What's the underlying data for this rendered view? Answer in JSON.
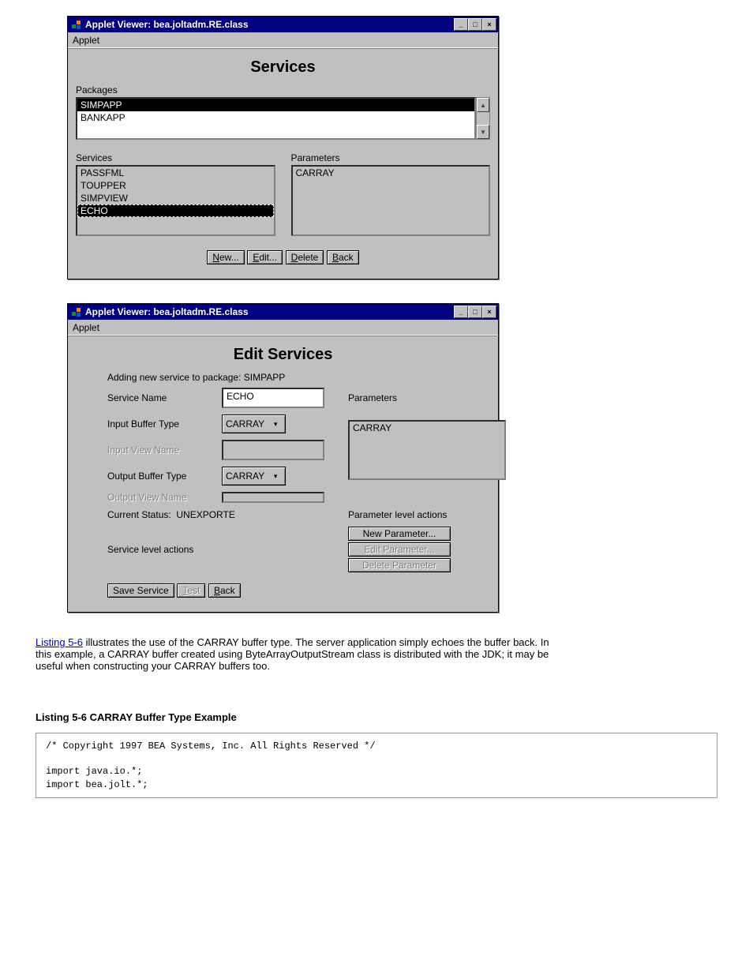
{
  "window1": {
    "title": "Applet Viewer: bea.joltadm.RE.class",
    "menu": "Applet",
    "heading": "Services",
    "packages_label": "Packages",
    "packages": [
      "SIMPAPP",
      "BANKAPP"
    ],
    "services_label": "Services",
    "services": [
      "PASSFML",
      "TOUPPER",
      "SIMPVIEW",
      "ECHO"
    ],
    "parameters_label": "Parameters",
    "parameters": [
      "CARRAY"
    ],
    "buttons": {
      "new": "New...",
      "edit": "Edit...",
      "delete": "Delete",
      "back": "Back"
    }
  },
  "window2": {
    "title": "Applet Viewer: bea.joltadm.RE.class",
    "menu": "Applet",
    "heading": "Edit Services",
    "subhead": "Adding new service to package: SIMPAPP",
    "labels": {
      "service_name": "Service Name",
      "input_buffer_type": "Input Buffer Type",
      "input_view_name": "Input View Name",
      "output_buffer_type": "Output Buffer Type",
      "output_view_name": "Output View Name",
      "current_status": "Current Status:",
      "service_actions": "Service level actions",
      "parameters": "Parameters",
      "param_actions": "Parameter level actions"
    },
    "values": {
      "service_name": "ECHO",
      "input_buffer_type": "CARRAY",
      "output_buffer_type": "CARRAY",
      "current_status": "UNEXPORTE"
    },
    "parameters": [
      "CARRAY"
    ],
    "buttons": {
      "new_param": "New Parameter...",
      "edit_param": "Edit Parameter...",
      "del_param": "Delete Parameter",
      "save": "Save Service",
      "test": "Test",
      "back": "Back"
    }
  },
  "link": "Listing 5-6",
  "bodytext": " illustrates the use of the CARRAY buffer type. The server application simply echoes the buffer back. In this example, a CARRAY buffer created using ByteArrayOutputStream class is distributed with the JDK; it may be useful when constructing your CARRAY buffers too.",
  "listing_caption": "Listing 5-6  CARRAY Buffer Type Example",
  "code": "/* Copyright 1997 BEA Systems, Inc. All Rights Reserved */\n\nimport java.io.*;\nimport bea.jolt.*;"
}
